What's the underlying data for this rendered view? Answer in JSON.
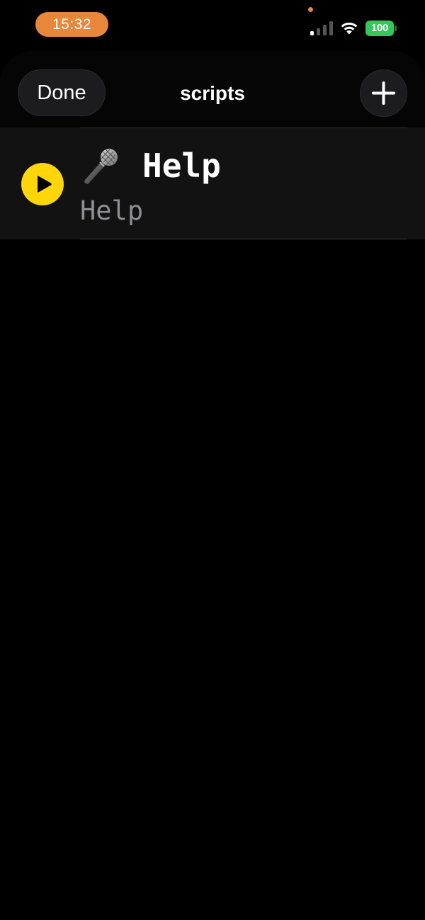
{
  "status_bar": {
    "time": "15:32",
    "battery_level": "100",
    "icons": [
      "cellular-signal-icon",
      "wifi-icon",
      "battery-icon"
    ],
    "signal_bars_active": 1,
    "signal_bars_total": 4
  },
  "header": {
    "done_label": "Done",
    "title": "scripts",
    "add_icon": "plus-icon"
  },
  "scripts": [
    {
      "emoji": "microphone-icon",
      "title": "Help",
      "subtitle": "Help",
      "action_icon": "play-icon"
    }
  ],
  "colors": {
    "time_pill": "#E8873A",
    "battery": "#34C759",
    "play_button": "#FFD60A",
    "background": "#000000",
    "row_background": "#121212",
    "subtitle": "#8e8e93"
  }
}
